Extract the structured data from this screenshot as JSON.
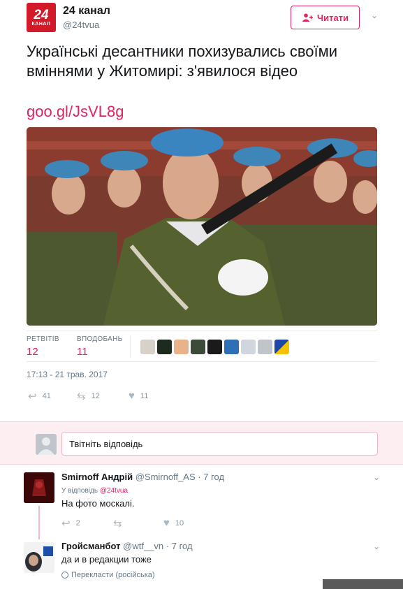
{
  "account": {
    "name": "24 канал",
    "handle": "@24tvua",
    "logo_number": "24",
    "logo_word": "КАНАЛ"
  },
  "follow_button": {
    "label": "Читати",
    "icon": "follow-icon"
  },
  "tweet": {
    "text": "Українські десантники похизувались своїми вміннями у Житомирі: з'явилося відео",
    "link": "goo.gl/JsVL8g",
    "timestamp": "17:13 - 21 трав. 2017"
  },
  "stats": {
    "retweets_label": "РЕТВІТІВ",
    "retweets_value": "12",
    "likes_label": "ВПОДОБАНЬ",
    "likes_value": "11"
  },
  "actions": {
    "reply_count": "41",
    "retweet_count": "12",
    "like_count": "11"
  },
  "reply_box": {
    "placeholder": "Твітніть відповідь"
  },
  "replies": [
    {
      "name": "Smirnoff Андрій",
      "handle": "@Smirnoff_AS",
      "time": "· 7 год",
      "in_reply_label": "У відповідь",
      "in_reply_handle": "@24tvua",
      "text": "На фото москалі.",
      "reply_count": "2",
      "retweet_count": "",
      "like_count": "10"
    },
    {
      "name": "Гройсманбот",
      "handle": "@wtf__vn",
      "time": "· 7 год",
      "text": "да и в редакции тоже",
      "translate": "Перекласти (російська)"
    }
  ],
  "colors": {
    "accent": "#e0245e",
    "secondary": "#657786",
    "reply_band": "#fdeef1"
  }
}
